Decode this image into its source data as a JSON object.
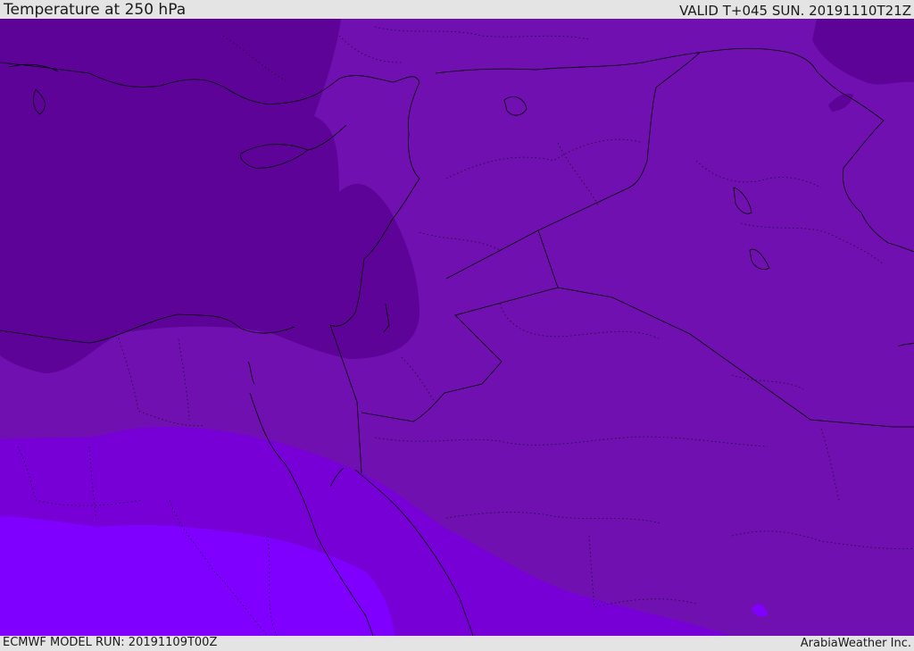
{
  "header": {
    "title": "Temperature at 250 hPa",
    "valid_time": "VALID T+045 SUN. 20191110T21Z"
  },
  "footer": {
    "model_run": "ECMWF MODEL RUN: 20191109T00Z",
    "credit": "ArabiaWeather Inc."
  },
  "map": {
    "field": "temperature-250hPa",
    "colors": {
      "coldest": "#5c0098",
      "cold": "#7010b0",
      "mid": "#7600d6",
      "warm": "#8000ff",
      "borders": "#000000"
    }
  }
}
